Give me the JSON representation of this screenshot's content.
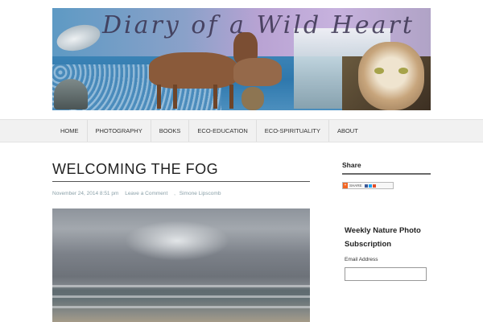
{
  "header": {
    "banner_title": "Diary of a Wild Heart"
  },
  "nav": {
    "items": [
      {
        "label": "HOME"
      },
      {
        "label": "PHOTOGRAPHY"
      },
      {
        "label": "BOOKS"
      },
      {
        "label": "ECO-EDUCATION"
      },
      {
        "label": "ECO-SPIRITUALITY"
      },
      {
        "label": "ABOUT"
      }
    ]
  },
  "post": {
    "title": "WELCOMING THE FOG",
    "date": "November 24, 2014 8:51 pm",
    "comments_link": "Leave a Comment",
    "author": "Simone Lipscomb",
    "separator": ","
  },
  "sidebar": {
    "share_heading": "Share",
    "share_button_label": "SHARE",
    "subscription_heading": "Weekly Nature Photo Subscription",
    "email_label": "Email Address",
    "email_placeholder": ""
  },
  "colors": {
    "accent_meta": "#8aa0a8",
    "nav_bg": "#f1f1f1",
    "share_orange": "#f26522"
  }
}
